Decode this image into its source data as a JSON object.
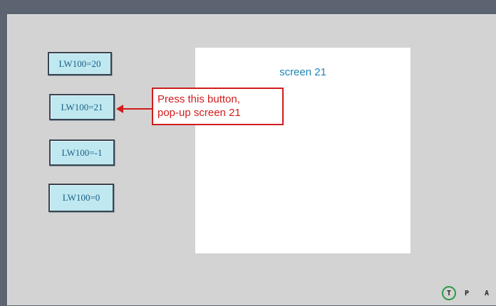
{
  "buttons": [
    {
      "label": "LW100=20"
    },
    {
      "label": "LW100=21"
    },
    {
      "label": "LW100=-1"
    },
    {
      "label": "LW100=0"
    }
  ],
  "popup": {
    "title": "screen 21"
  },
  "callout": {
    "line1": "Press this button,",
    "line2": "pop-up screen 21"
  },
  "status": {
    "t": "T",
    "p": "P",
    "a": "A"
  },
  "colors": {
    "frame": "#5b6470",
    "panel": "#d3d3d3",
    "button_fill": "#bfe8f0",
    "button_text": "#1b5f86",
    "popup_title": "#1e86b8",
    "callout": "#d11c1c",
    "status_ring": "#2f9a4a"
  }
}
